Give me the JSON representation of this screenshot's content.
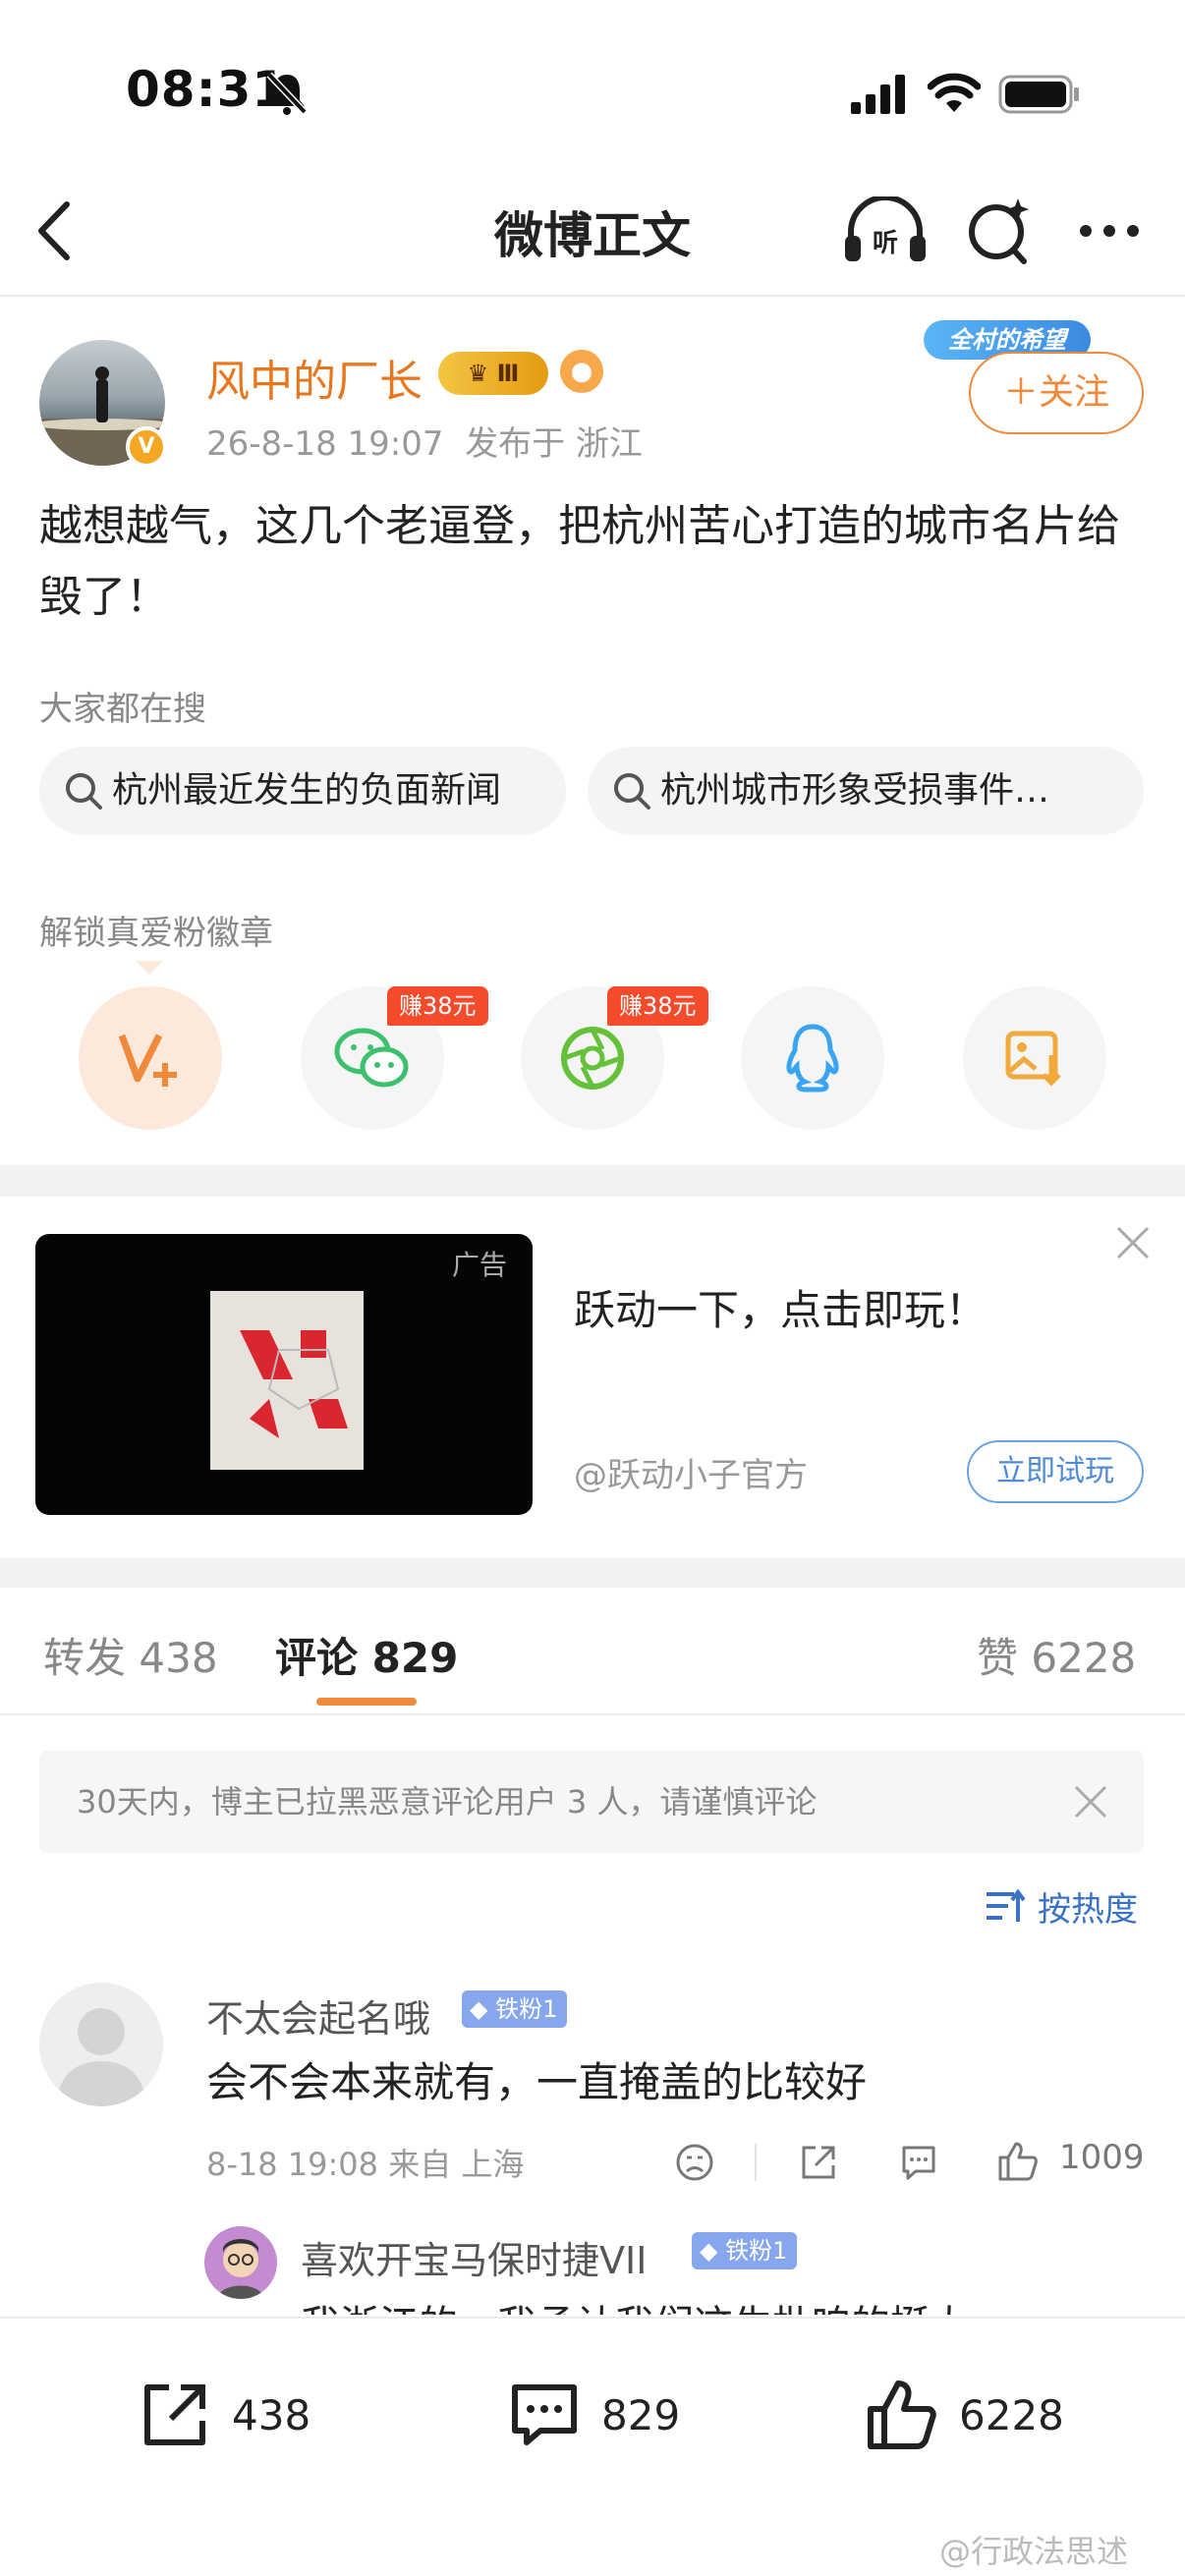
{
  "status_bar": {
    "time": "08:31"
  },
  "nav": {
    "title": "微博正文"
  },
  "post": {
    "username": "风中的厂长",
    "level_badge": "Ⅲ",
    "verified_badge": "V",
    "timestamp": "26-8-18 19:07",
    "location": "发布于 浙江",
    "promo_tag": "全村的希望",
    "follow_label": "＋关注",
    "text": "越想越气，这几个老逼登，把杭州苦心打造的城市名片给毁了！"
  },
  "everyone_searching": {
    "label": "大家都在搜",
    "items": [
      "杭州最近发生的负面新闻",
      "杭州城市形象受损事件…"
    ]
  },
  "fan_badge_section": {
    "label": "解锁真爱粉徽章",
    "earn_badges": [
      "赚38元",
      "赚38元"
    ]
  },
  "ad": {
    "tag": "广告",
    "title": "跃动一下，点击即玩！",
    "source": "@跃动小子官方",
    "cta": "立即试玩"
  },
  "tabs": {
    "repost": {
      "label": "转发",
      "count": "438"
    },
    "comments": {
      "label": "评论",
      "count": "829"
    },
    "likes": {
      "label": "赞",
      "count": "6228"
    }
  },
  "notice": "30天内，博主已拉黑恶意评论用户 3 人，请谨慎评论",
  "sort_label": "按热度",
  "comments": [
    {
      "username": "不太会起名哦",
      "fan_badge": "铁粉1",
      "text": "会不会本来就有，一直掩盖的比较好",
      "meta": "8-18 19:08  来自 上海",
      "likes": "1009"
    }
  ],
  "reply": {
    "username": "喜欢开宝马保时捷VII",
    "fan_badge": "铁粉1",
    "text": "我浙江的，我承认我们这生批咱的挺大"
  },
  "bottom_bar": {
    "repost": "438",
    "comment": "829",
    "like": "6228"
  },
  "watermark": "@行政法思述",
  "colors": {
    "accent_orange": "#f08a3a",
    "link_blue": "#3a72c4",
    "earn_red": "#f34b2b"
  }
}
